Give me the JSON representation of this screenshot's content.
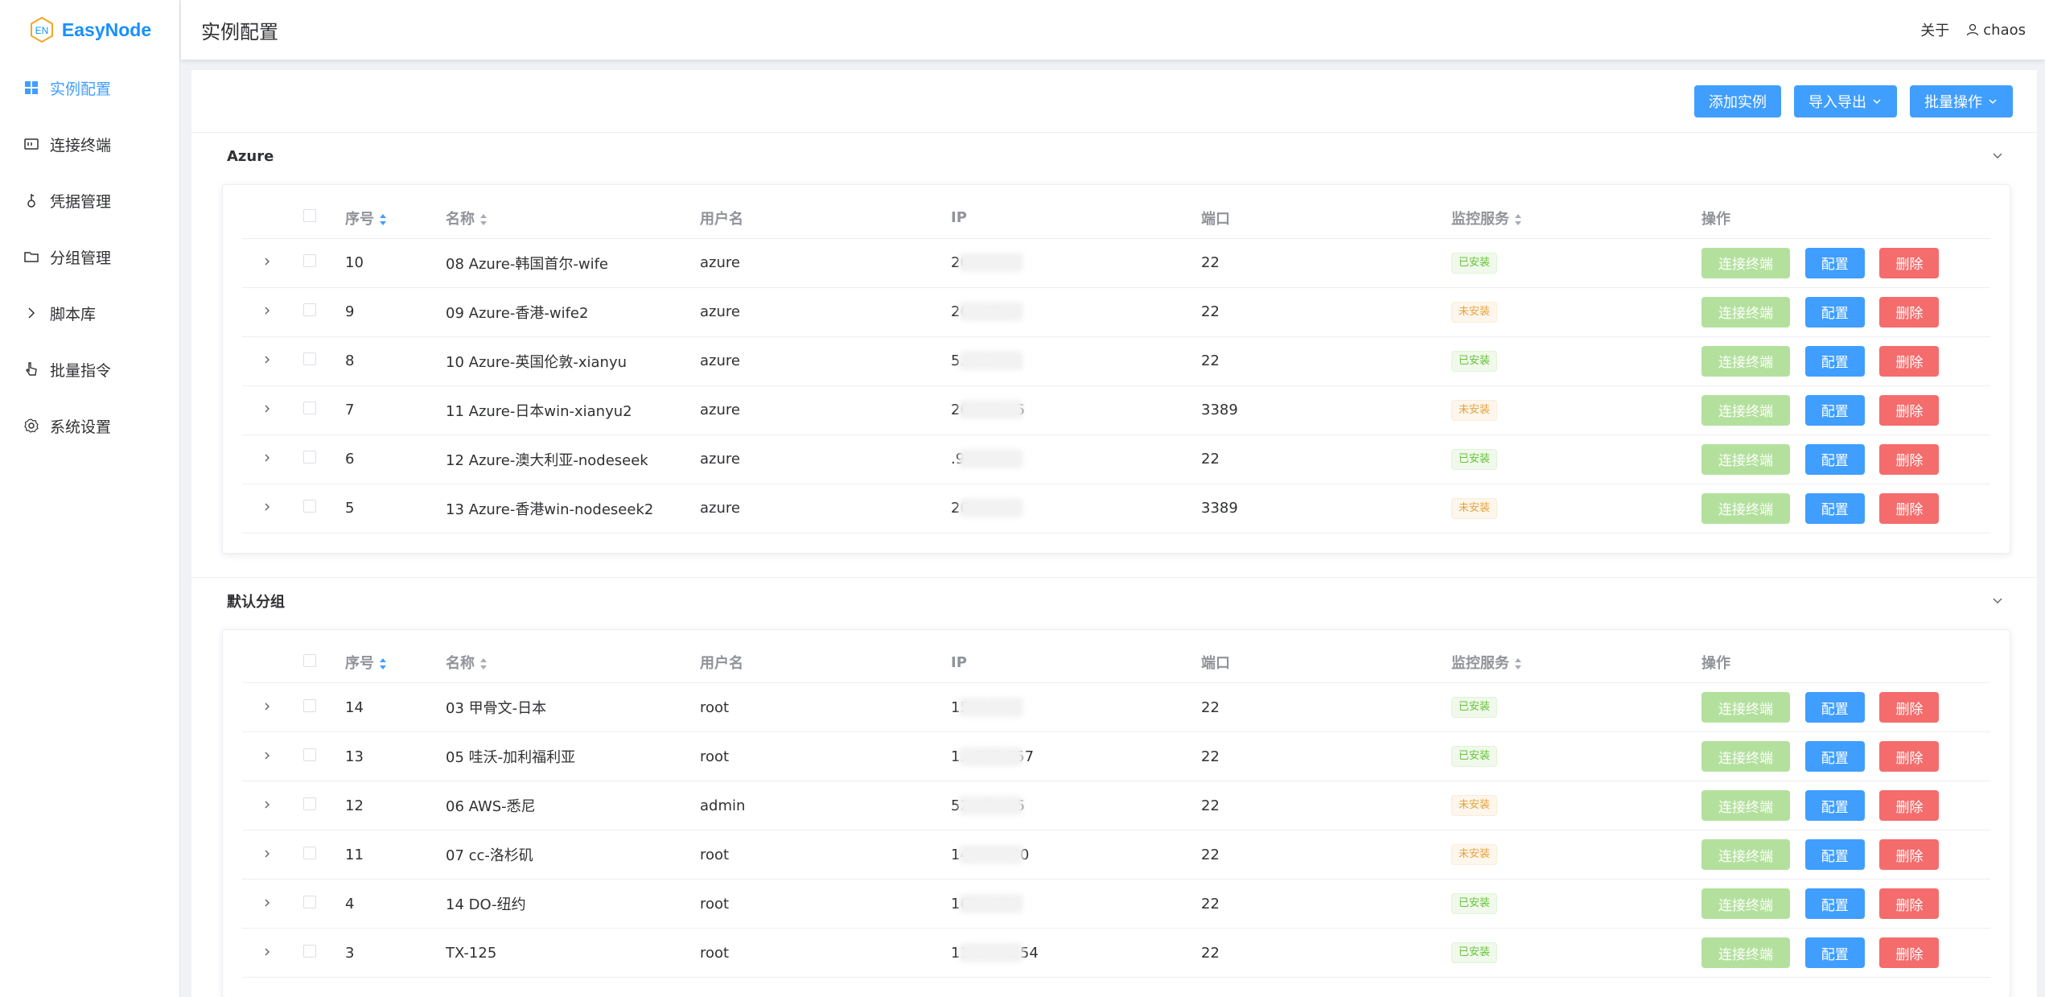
{
  "app": {
    "logo_text": "EasyNode",
    "logo_badge": "EN"
  },
  "sidebar": {
    "items": [
      {
        "label": "实例配置",
        "icon": "grid-icon",
        "active": true
      },
      {
        "label": "连接终端",
        "icon": "terminal-icon",
        "active": false
      },
      {
        "label": "凭据管理",
        "icon": "key-icon",
        "active": false
      },
      {
        "label": "分组管理",
        "icon": "folder-icon",
        "active": false
      },
      {
        "label": "脚本库",
        "icon": "chevron-right-icon",
        "active": false
      },
      {
        "label": "批量指令",
        "icon": "pointer-icon",
        "active": false
      },
      {
        "label": "系统设置",
        "icon": "gear-icon",
        "active": false
      }
    ]
  },
  "header": {
    "title": "实例配置",
    "about": "关于",
    "user": "chaos"
  },
  "toolbar": {
    "add": "添加实例",
    "import_export": "导入导出",
    "batch": "批量操作"
  },
  "columns": {
    "idx": "序号",
    "name": "名称",
    "username": "用户名",
    "ip": "IP",
    "port": "端口",
    "monitor": "监控服务",
    "ops": "操作"
  },
  "ops": {
    "terminal": "连接终端",
    "config": "配置",
    "delete": "删除"
  },
  "status_labels": {
    "installed": "已安装",
    "not_installed": "未安装"
  },
  "colors": {
    "primary": "#409eff",
    "success": "#67c23a",
    "warning": "#e6a23c",
    "danger": "#f56c6c",
    "success_light": "#b3e19d"
  },
  "groups": [
    {
      "name": "Azure",
      "rows": [
        {
          "idx": "10",
          "name": "08 Azure-韩国首尔-wife",
          "user": "azure",
          "ip": "20.      .193",
          "port": "22",
          "status": "已安装",
          "status_key": "ok"
        },
        {
          "idx": "9",
          "name": "09 Azure-香港-wife2",
          "user": "azure",
          "ip": "20.      .42",
          "port": "22",
          "status": "未安装",
          "status_key": "no"
        },
        {
          "idx": "8",
          "name": "10 Azure-英国伦敦-xianyu",
          "user": "azure",
          "ip": "5.      .18",
          "port": "22",
          "status": "已安装",
          "status_key": "ok"
        },
        {
          "idx": "7",
          "name": "11 Azure-日本win-xianyu2",
          "user": "azure",
          "ip": "20.255.   .6",
          "port": "3389",
          "status": "未安装",
          "status_key": "no"
        },
        {
          "idx": "6",
          "name": "12 Azure-澳大利亚-nodeseek",
          "user": "azure",
          "ip": "       .9",
          "port": "22",
          "status": "已安装",
          "status_key": "ok"
        },
        {
          "idx": "5",
          "name": "13 Azure-香港win-nodeseek2",
          "user": "azure",
          "ip": "20.",
          "port": "3389",
          "status": "未安装",
          "status_key": "no"
        }
      ]
    },
    {
      "name": "默认分组",
      "rows": [
        {
          "idx": "14",
          "name": "03 甲骨文-日本",
          "user": "root",
          "ip": "15      .48",
          "port": "22",
          "status": "已安装",
          "status_key": "ok"
        },
        {
          "idx": "13",
          "name": "05 哇沃-加利福利亚",
          "user": "root",
          "ip": "1.   .207.157",
          "port": "22",
          "status": "已安装",
          "status_key": "ok"
        },
        {
          "idx": "12",
          "name": "06 AWS-悉尼",
          "user": "admin",
          "ip": "52.63.   .26",
          "port": "22",
          "status": "未安装",
          "status_key": "no"
        },
        {
          "idx": "11",
          "name": "07 cc-洛杉矶",
          "user": "root",
          "ip": "14    .43.240",
          "port": "22",
          "status": "未安装",
          "status_key": "no"
        },
        {
          "idx": "4",
          "name": "14 DO-纽约",
          "user": "root",
          "ip": "165.      .47",
          "port": "22",
          "status": "已安装",
          "status_key": "ok"
        },
        {
          "idx": "3",
          "name": "TX-125",
          "user": "root",
          "ip": "11   .240.254",
          "port": "22",
          "status": "已安装",
          "status_key": "ok"
        }
      ]
    }
  ]
}
